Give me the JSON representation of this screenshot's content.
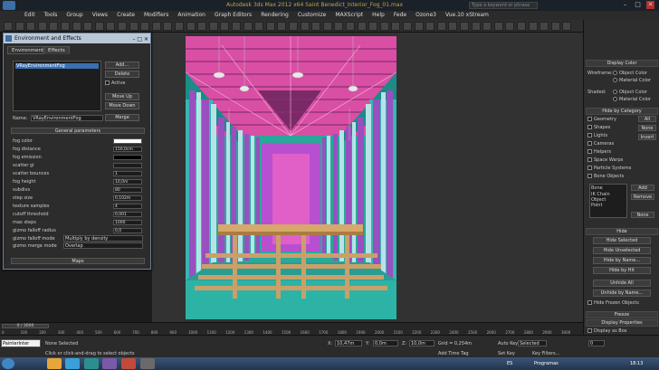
{
  "window": {
    "title": "Autodesk 3ds Max 2012 x64     Saint Benedict_Interior_Fog_01.max",
    "search_placeholder": "Type a keyword or phrase",
    "min": "–",
    "max": "□",
    "close": "✕"
  },
  "menu": [
    "Edit",
    "Tools",
    "Group",
    "Views",
    "Create",
    "Modifiers",
    "Animation",
    "Graph Editors",
    "Rendering",
    "Customize",
    "MAXScript",
    "Help",
    "Fede",
    "Ozone3",
    "Vue.10 xStream"
  ],
  "env_dialog": {
    "title": "Environment and Effects",
    "tabs": [
      "Environment",
      "Effects"
    ],
    "effect_item": "VRayEnvironmentFog",
    "buttons": {
      "add": "Add...",
      "delete": "Delete",
      "move_up": "Move Up",
      "move_down": "Move Down",
      "merge": "Merge"
    },
    "active_label": "Active",
    "name_label": "Name:",
    "name_value": "VRayEnvironmentFog",
    "section_general": "General parameters",
    "section_maps": "Maps",
    "params": [
      {
        "label": "fog color",
        "value": ""
      },
      {
        "label": "fog distance",
        "value": "150,0cm"
      },
      {
        "label": "fog emission",
        "value": ""
      },
      {
        "label": "scatter gi",
        "value": ""
      },
      {
        "label": "scatter bounces",
        "value": "1"
      },
      {
        "label": "fog height",
        "value": "10,0m"
      },
      {
        "label": "subdivs",
        "value": "80"
      },
      {
        "label": "step size",
        "value": "0,102m"
      },
      {
        "label": "texture samples",
        "value": "4"
      },
      {
        "label": "cutoff threshold",
        "value": "0,001"
      },
      {
        "label": "max steps",
        "value": "1000"
      },
      {
        "label": "gizmo falloff radius",
        "value": "0,0"
      }
    ],
    "gizmo_mode_label": "gizmo falloff mode",
    "gizmo_mode_value": "Multiply by density",
    "gizmo_merge_label": "gizmo merge mode",
    "gizmo_merge_value": "Overlap",
    "colors": {
      "fog": "#ffffff",
      "emission": "#000000"
    }
  },
  "command_panel": {
    "display_color": "Display Color",
    "wireframe_label": "Wireframe:",
    "shaded_label": "Shaded:",
    "object_color": "Object Color",
    "material_color": "Material Color",
    "hide_by_category": "Hide by Category",
    "categories": [
      "Geometry",
      "Shapes",
      "Lights",
      "Cameras",
      "Helpers",
      "Space Warps",
      "Particle Systems",
      "Bone Objects"
    ],
    "cat_buttons": {
      "all": "All",
      "none": "None",
      "invert": "Invert"
    },
    "list_items": [
      "Bone",
      "IK Chain Object",
      "Point"
    ],
    "list_buttons": {
      "add": "Add",
      "remove": "Remove",
      "none": "None"
    },
    "hide": "Hide",
    "hide_buttons": [
      "Hide Selected",
      "Hide Unselected",
      "Hide by Name...",
      "Hide by Hit",
      "Unhide All",
      "Unhide by Name..."
    ],
    "hide_frozen": "Hide Frozen Objects",
    "freeze": "Freeze",
    "display_properties": "Display Properties",
    "display_as_box": "Display as Box"
  },
  "timeline": {
    "slider": "0 / 3000",
    "ticks": [
      "0",
      "100",
      "200",
      "300",
      "400",
      "500",
      "600",
      "700",
      "800",
      "900",
      "1000",
      "1100",
      "1200",
      "1300",
      "1400",
      "1500",
      "1600",
      "1700",
      "1800",
      "1900",
      "2000",
      "2100",
      "2200",
      "2300",
      "2400",
      "2500",
      "2600",
      "2700",
      "2800",
      "2900",
      "3000"
    ]
  },
  "status": {
    "script_label": "PainterInter",
    "selected": "None Selected",
    "prompt": "Click or click-and-drag to select objects",
    "x": "10,47m",
    "y": "0,0m",
    "z": "10,0m",
    "grid": "Grid = 0,254m",
    "add_time_tag": "Add Time Tag",
    "auto_key": "Auto Key",
    "set_key": "Set Key",
    "selected_dd": "Selected",
    "key_filters": "Key Filters...",
    "frame": "0"
  },
  "taskbar": {
    "lang": "ES",
    "tray_label": "Programas",
    "time": "18:13"
  }
}
